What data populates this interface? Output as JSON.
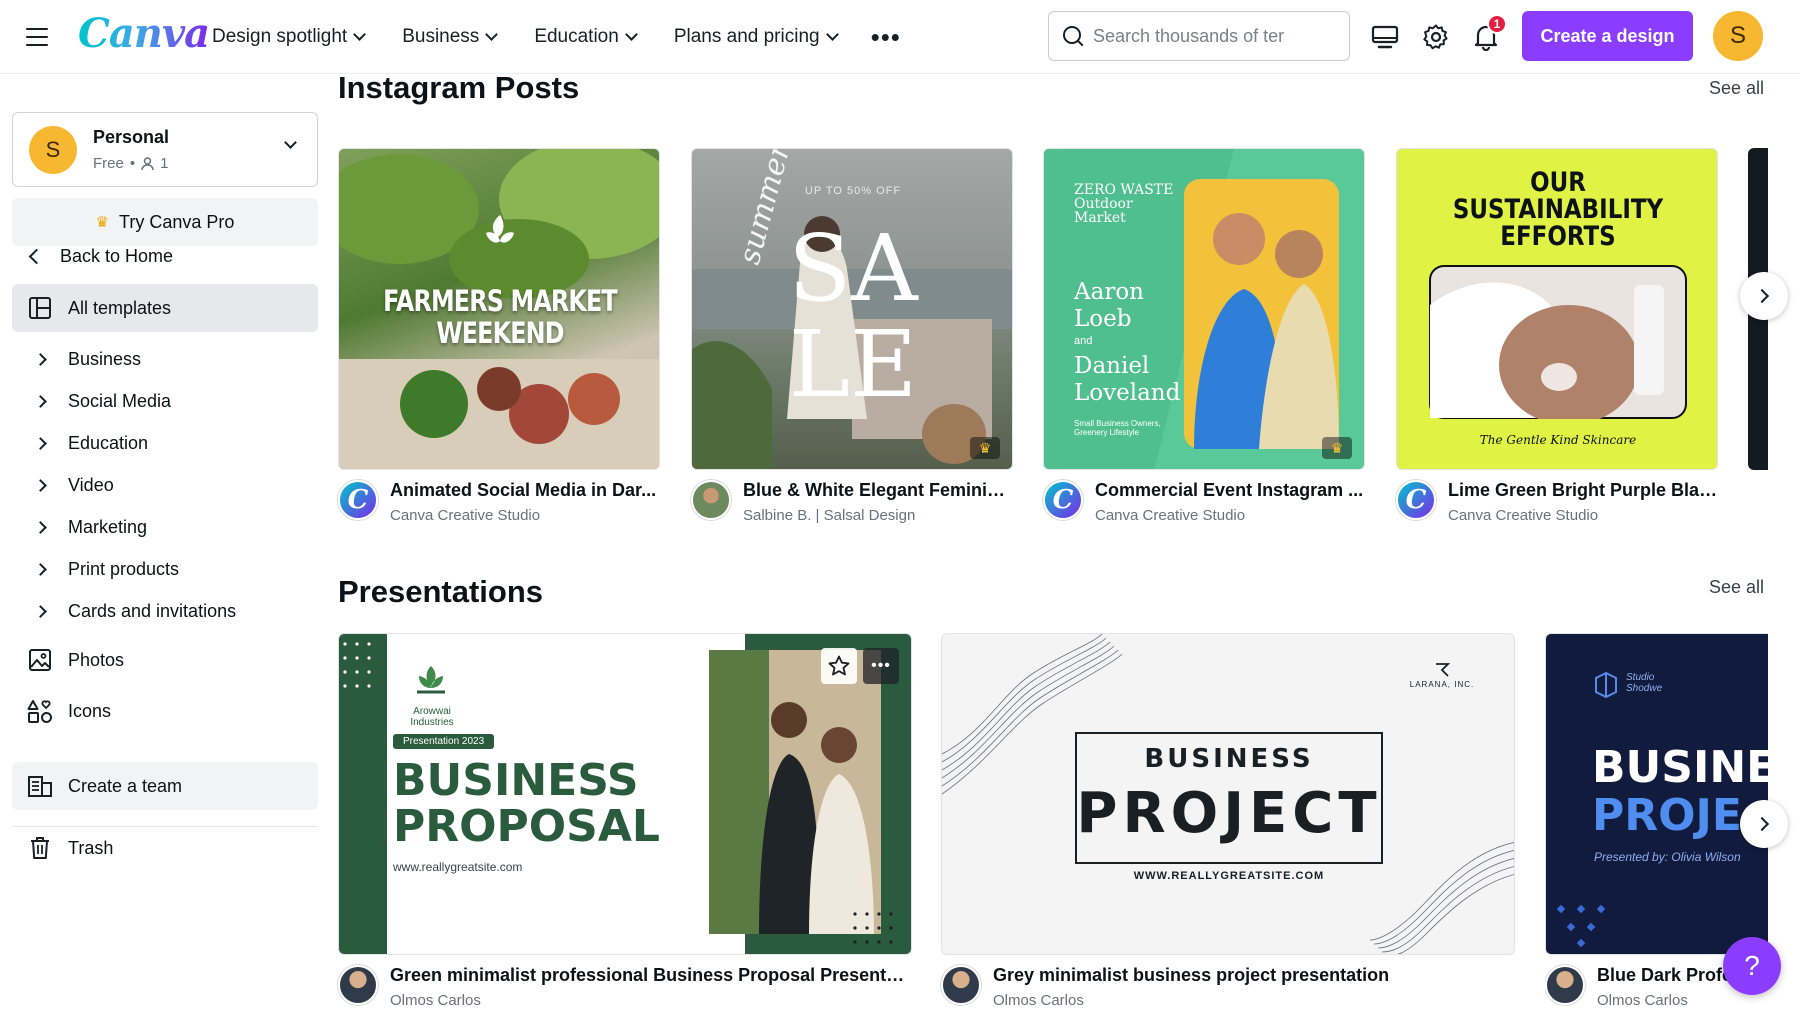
{
  "header": {
    "logo": "Canva",
    "nav": [
      {
        "label": "Design spotlight"
      },
      {
        "label": "Business"
      },
      {
        "label": "Education"
      },
      {
        "label": "Plans and pricing"
      }
    ],
    "more": "•••",
    "search_placeholder": "Search thousands of ter",
    "notification_count": "1",
    "create_label": "Create a design",
    "avatar_initial": "S"
  },
  "sidebar": {
    "account": {
      "initial": "S",
      "name": "Personal",
      "plan": "Free",
      "members": "1"
    },
    "try_pro": "Try Canva Pro",
    "back": "Back to Home",
    "all_templates": "All templates",
    "categories": [
      "Business",
      "Social Media",
      "Education",
      "Video",
      "Marketing",
      "Print products",
      "Cards and invitations"
    ],
    "photos": "Photos",
    "icons": "Icons",
    "create_team": "Create a team",
    "trash": "Trash"
  },
  "main": {
    "instagram": {
      "title": "Instagram Posts",
      "see_all": "See all",
      "cards": [
        {
          "title": "Animated Social Media in Dar...",
          "author": "Canva Creative Studio",
          "art": "FARMERS MARKET WEEKEND"
        },
        {
          "title": "Blue & White Elegant Feminin...",
          "author": "Salbine B. | Salsal Design",
          "art_small": "UP TO 50% OFF",
          "art_big1": "SA",
          "art_big2": "LE",
          "art_script": "summer"
        },
        {
          "title": "Commercial Event Instagram ...",
          "author": "Canva Creative Studio",
          "art_top": "ZERO WASTE Outdoor Market",
          "art_name1": "Aaron Loeb",
          "art_and": "and",
          "art_name2": "Daniel Loveland",
          "art_small": "Small Business Owners, Greenery Lifestyle"
        },
        {
          "title": "Lime Green Bright Purple Blac...",
          "author": "Canva Creative Studio",
          "art_title": "OUR SUSTAINABILITY EFFORTS",
          "art_footer": "The Gentle Kind Skincare"
        }
      ]
    },
    "presentations": {
      "title": "Presentations",
      "see_all": "See all",
      "cards": [
        {
          "title": "Green minimalist professional Business Proposal Presentati...",
          "author": "Olmos Carlos",
          "art_company": "Arowwai Industries",
          "art_tag": "Presentation 2023",
          "art_l1": "BUSINESS",
          "art_l2": "PROPOSAL",
          "art_url": "www.reallygreatsite.com"
        },
        {
          "title": "Grey minimalist business project presentation",
          "author": "Olmos Carlos",
          "art_brand": "LARANA, INC.",
          "art_l1": "BUSINESS",
          "art_l2": "PROJECT",
          "art_url": "WWW.REALLYGREATSITE.COM"
        },
        {
          "title": "Blue Dark Profe",
          "author": "Olmos Carlos",
          "art_brand": "Studio Shodwe",
          "art_l1": "BUSINE",
          "art_l2": "PROJE",
          "art_sub": "Presented by: Olivia Wilson"
        }
      ]
    }
  },
  "help": "?",
  "colors": {
    "accent": "#8b3dff",
    "badge": "#e41e3f",
    "avatar": "#f7b731"
  }
}
